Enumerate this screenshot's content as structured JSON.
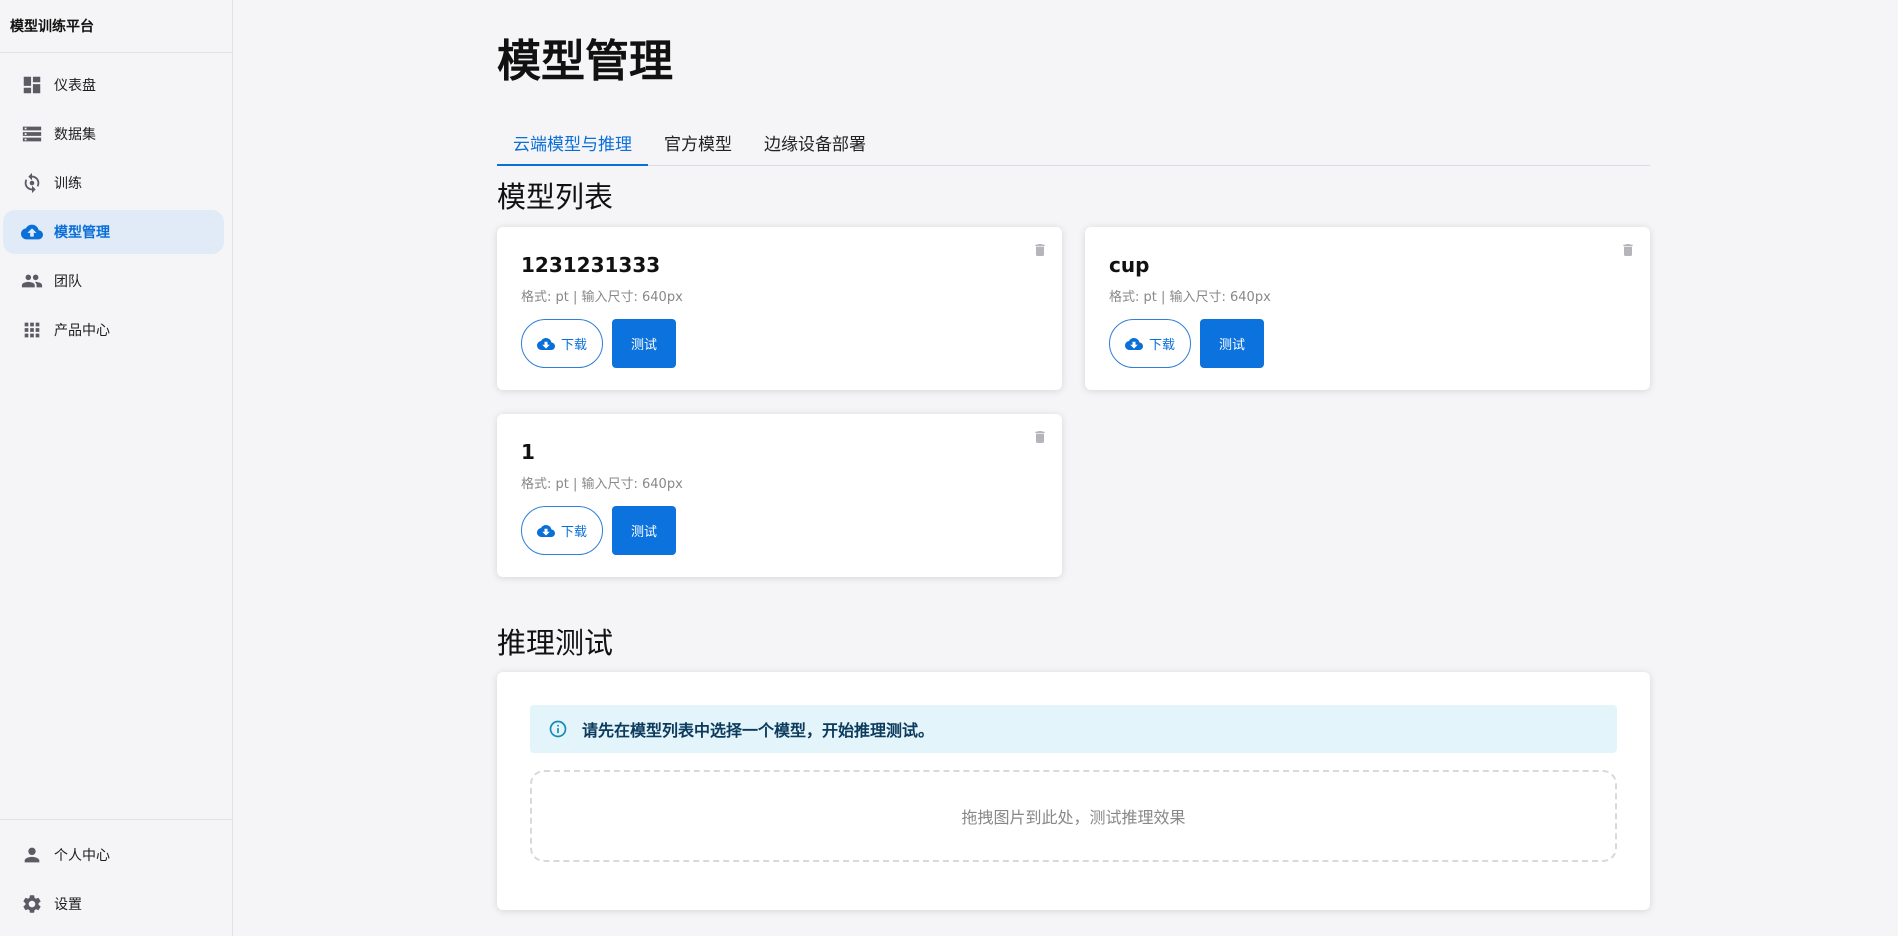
{
  "sidebar": {
    "brand": "模型训练平台",
    "items": [
      {
        "label": "仪表盘",
        "icon": "dashboard-icon"
      },
      {
        "label": "数据集",
        "icon": "dataset-list-icon"
      },
      {
        "label": "训练",
        "icon": "training-icon"
      },
      {
        "label": "模型管理",
        "icon": "cloud-upload-icon"
      },
      {
        "label": "团队",
        "icon": "team-icon"
      },
      {
        "label": "产品中心",
        "icon": "apps-grid-icon"
      }
    ],
    "bottom_items": [
      {
        "label": "个人中心",
        "icon": "person-icon"
      },
      {
        "label": "设置",
        "icon": "gear-icon"
      }
    ],
    "active_index": 3
  },
  "main": {
    "title": "模型管理",
    "tabs": [
      {
        "label": "云端模型与推理"
      },
      {
        "label": "官方模型"
      },
      {
        "label": "边缘设备部署"
      }
    ],
    "active_tab": 0,
    "model_list_title": "模型列表",
    "models": [
      {
        "name": "1231231333",
        "meta": "格式: pt | 输入尺寸: 640px",
        "download_label": "下载",
        "test_label": "测试"
      },
      {
        "name": "cup",
        "meta": "格式: pt | 输入尺寸: 640px",
        "download_label": "下载",
        "test_label": "测试"
      },
      {
        "name": "1",
        "meta": "格式: pt | 输入尺寸: 640px",
        "download_label": "下载",
        "test_label": "测试"
      }
    ],
    "inference_title": "推理测试",
    "inference_alert": "请先在模型列表中选择一个模型，开始推理测试。",
    "dropzone_text": "拖拽图片到此处，测试推理效果"
  },
  "colors": {
    "accent": "#0b6fd8",
    "active_nav_bg": "#e1ebf7",
    "alert_bg": "#e3f4fb"
  }
}
